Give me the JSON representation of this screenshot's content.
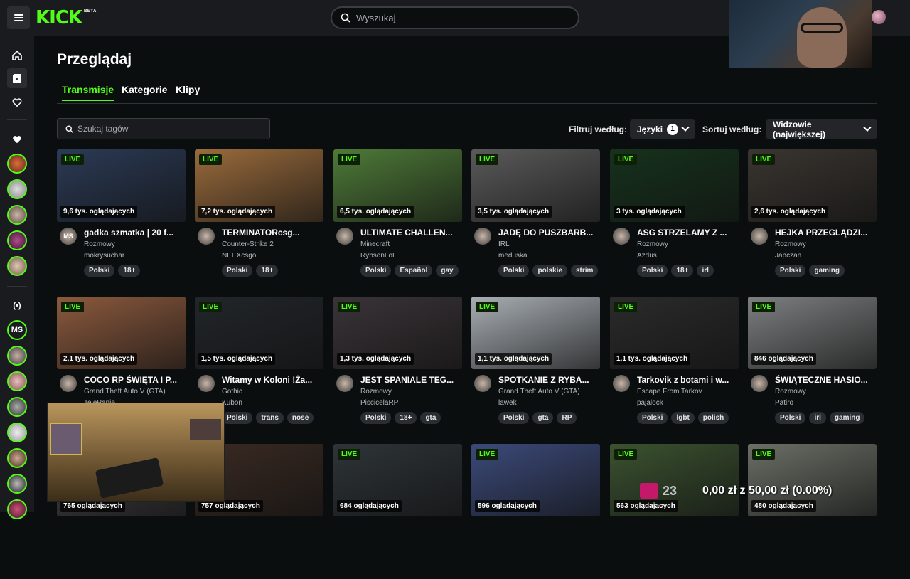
{
  "header": {
    "logo": "KICK",
    "logo_badge": "BETA",
    "search_placeholder": "Wyszukaj"
  },
  "sidebar": {
    "icons": [
      "home-icon",
      "browse-icon",
      "heart-icon"
    ],
    "following_initials": "MS"
  },
  "page": {
    "title": "Przeglądaj",
    "tabs": [
      "Transmisje",
      "Kategorie",
      "Klipy"
    ],
    "active_tab": "Transmisje",
    "tag_search_placeholder": "Szukaj tagów",
    "filter_label": "Filtruj według:",
    "language_dropdown": "Języki",
    "language_count": "1",
    "sort_label": "Sortuj według:",
    "sort_value": "Widzowie (największej)"
  },
  "live_label": "LIVE",
  "streams": [
    {
      "viewers": "9,6 tys. oglądających",
      "title": "gadka szmatka | 20 f...",
      "category": "Rozmowy",
      "user": "mokrysuchar",
      "tags": [
        "Polski",
        "18+"
      ],
      "avatar": "MS",
      "color": "#2b3a55"
    },
    {
      "viewers": "7,2 tys. oglądających",
      "title": "TERMINATORcsg...",
      "category": "Counter-Strike 2",
      "user": "NEEXcsgo",
      "tags": [
        "Polski",
        "18+"
      ],
      "avatar": "",
      "color": "#9a6b3c"
    },
    {
      "viewers": "6,5 tys. oglądających",
      "title": "ULTIMATE CHALLEN...",
      "category": "Minecraft",
      "user": "RybsonLoL",
      "tags": [
        "Polski",
        "Español",
        "gay"
      ],
      "avatar": "",
      "color": "#4e7a38"
    },
    {
      "viewers": "3,5 tys. oglądających",
      "title": "JADĘ DO PUSZBARB...",
      "category": "IRL",
      "user": "meduska",
      "tags": [
        "Polski",
        "polskie",
        "strim"
      ],
      "avatar": "",
      "color": "#5a5a5a"
    },
    {
      "viewers": "3 tys. oglądających",
      "title": "ASG STRZELAMY Z ...",
      "category": "Rozmowy",
      "user": "Azdus",
      "tags": [
        "Polski",
        "18+",
        "irl"
      ],
      "avatar": "",
      "color": "#16321c"
    },
    {
      "viewers": "2,6 tys. oglądających",
      "title": "HEJKA PRZEGLĄDZI...",
      "category": "Rozmowy",
      "user": "Japczan",
      "tags": [
        "Polski",
        "gaming"
      ],
      "avatar": "",
      "color": "#3a3530"
    },
    {
      "viewers": "2,1 tys. oglądających",
      "title": "COCO RP ŚWIĘTA I P...",
      "category": "Grand Theft Auto V (GTA)",
      "user": "TelePanie",
      "tags": [],
      "avatar": "",
      "color": "#8c5a3e"
    },
    {
      "viewers": "1,5 tys. oglądających",
      "title": "Witamy w Koloni !Ża...",
      "category": "Gothic",
      "user": "Kubon",
      "tags": [
        "Polski",
        "trans",
        "nose"
      ],
      "avatar": "",
      "color": "#22262a"
    },
    {
      "viewers": "1,3 tys. oglądających",
      "title": "JEST SPANIALE TEG...",
      "category": "Rozmowy",
      "user": "PiscicelaRP",
      "tags": [
        "Polski",
        "18+",
        "gta"
      ],
      "avatar": "",
      "color": "#3a3438"
    },
    {
      "viewers": "1,1 tys. oglądających",
      "title": "SPOTKANIE Z RYBA...",
      "category": "Grand Theft Auto V (GTA)",
      "user": "lawek",
      "tags": [
        "Polski",
        "gta",
        "RP"
      ],
      "avatar": "",
      "color": "#a8aeb4"
    },
    {
      "viewers": "1,1 tys. oglądających",
      "title": "Tarkovik z botami i w...",
      "category": "Escape From Tarkov",
      "user": "pajalock",
      "tags": [
        "Polski",
        "lgbt",
        "polish"
      ],
      "avatar": "",
      "color": "#2b2b2b"
    },
    {
      "viewers": "846 oglądających",
      "title": "ŚWIĄTECZNE HASIO...",
      "category": "Rozmowy",
      "user": "Patiro",
      "tags": [
        "Polski",
        "irl",
        "gaming"
      ],
      "avatar": "",
      "color": "#7d7f80"
    },
    {
      "viewers": "765 oglądających",
      "color": "#444"
    },
    {
      "viewers": "757 oglądających",
      "color": "#3a2a22"
    },
    {
      "viewers": "684 oglądających",
      "color": "#2e3438"
    },
    {
      "viewers": "596 oglądających",
      "color": "#3c4a7a"
    },
    {
      "viewers": "563 oglądających",
      "color": "#3b5230"
    },
    {
      "viewers": "480 oglądających",
      "color": "#6b6f66"
    }
  ],
  "donation": {
    "count": "23",
    "text": "0,00 zł z 50,00 zł (0.00%)"
  },
  "colors": {
    "accent": "#53fc18",
    "background": "#0b0e0f",
    "panel": "#191b1f"
  }
}
